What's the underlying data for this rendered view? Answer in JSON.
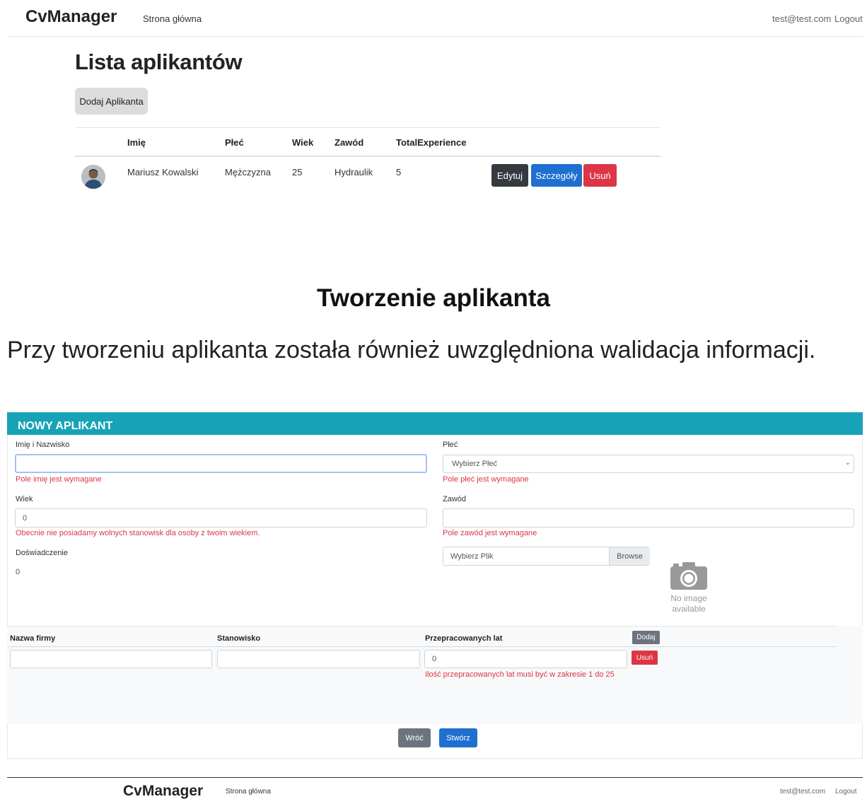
{
  "nav": {
    "brand": "CvManager",
    "home": "Strona główna",
    "user": "test@test.com",
    "logout": "Logout"
  },
  "list": {
    "title": "Lista aplikantów",
    "add_button": "Dodaj Aplikanta",
    "headers": [
      "Imię",
      "Płeć",
      "Wiek",
      "Zawód",
      "TotalExperience"
    ],
    "row": {
      "name": "Mariusz Kowalski",
      "gender": "Mężczyzna",
      "age": "25",
      "job": "Hydraulik",
      "experience": "5"
    },
    "actions": {
      "edit": "Edytuj",
      "details": "Szczegóły",
      "delete": "Usuń"
    }
  },
  "section": {
    "title": "Tworzenie aplikanta",
    "description": "Przy tworzeniu aplikanta została również uwzględniona walidacja informacji."
  },
  "form": {
    "header": "NOWY APLIKANT",
    "name_label": "Imię i Nazwisko",
    "name_value": "",
    "name_error": "Pole imię jest wymagane",
    "gender_label": "Płeć",
    "gender_value": "Wybierz Płeć",
    "gender_error": "Pole płeć jest wymagane",
    "age_label": "Wiek",
    "age_value": "0",
    "age_error": "Obecnie nie posiadamy wolnych stanowisk dla osoby z twoim wiekiem.",
    "job_label": "Zawód",
    "job_value": "",
    "job_error": "Pole zawód jest wymagane",
    "experience_label": "Doświadczenie",
    "experience_value": "0",
    "file_placeholder": "Wybierz Plik",
    "browse": "Browse",
    "no_image_line1": "No image",
    "no_image_line2": "available",
    "company_header": "Nazwa firmy",
    "position_header": "Stanowisko",
    "years_header": "Przepracowanych lat",
    "add_row": "Dodaj",
    "company_value": "",
    "position_value": "",
    "years_value": "0",
    "remove_row": "Usuń",
    "years_error": "Ilość przepracowanych lat musi być w zakresie 1 do 25",
    "back": "Wróć",
    "create": "Stwórz"
  },
  "colors": {
    "header": "#17a2b8",
    "error": "#dc3545",
    "primary": "#1f6fd0",
    "dark": "#343a40"
  }
}
